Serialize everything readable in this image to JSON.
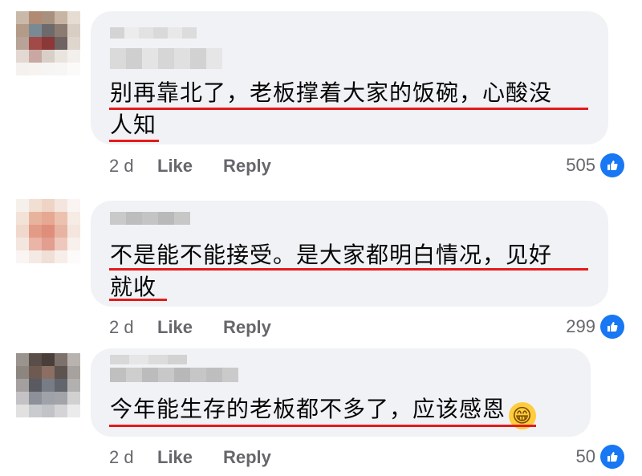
{
  "comments": [
    {
      "text_line1": "别再靠北了，老板撑着大家的饭碗，心酸没",
      "text_line2": "人知",
      "time": "2 d",
      "like_label": "Like",
      "reply_label": "Reply",
      "like_count": "505",
      "icon": "thumbs-up-icon"
    },
    {
      "text_line1": "不是能不能接受。是大家都明白情况，见好",
      "text_line2": "就收",
      "time": "2 d",
      "like_label": "Like",
      "reply_label": "Reply",
      "like_count": "299",
      "icon": "thumbs-up-icon"
    },
    {
      "text_line1": "今年能生存的老板都不多了，应该感恩",
      "emoji": "grinning-face-emoji",
      "time": "2 d",
      "like_label": "Like",
      "reply_label": "Reply",
      "like_count": "50",
      "icon": "thumbs-up-icon"
    }
  ],
  "colors": {
    "bubble": "#f0f2f5",
    "underline": "#e41b1b",
    "like_badge": "#1877f2",
    "meta_text": "#65676b"
  }
}
